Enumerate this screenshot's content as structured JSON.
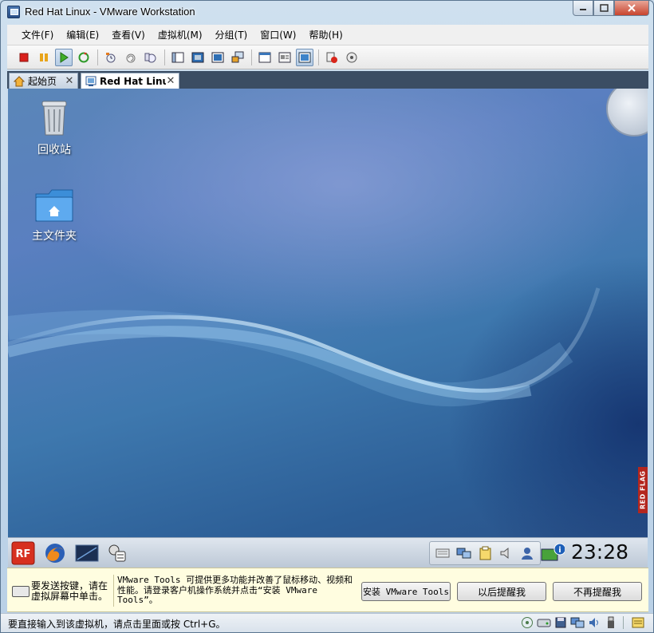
{
  "window": {
    "title": "Red Hat Linux - VMware Workstation"
  },
  "menu": [
    "文件(F)",
    "编辑(E)",
    "查看(V)",
    "虚拟机(M)",
    "分组(T)",
    "窗口(W)",
    "帮助(H)"
  ],
  "toolbar": {
    "groups": [
      [
        "stop-icon",
        "pause-icon",
        "play-icon",
        "reset-icon"
      ],
      [
        "snapshot-icon",
        "revert-snapshot-icon",
        "snapshot-manager-icon"
      ],
      [
        "sidebar-icon",
        "fullscreen-icon",
        "quick-switch-icon",
        "console-view-icon"
      ],
      [
        "summary-view-icon",
        "appliance-view-icon",
        "console-tab-icon"
      ],
      [
        "team-icon",
        "settings-icon"
      ]
    ],
    "pressed": [
      "play-icon",
      "console-tab-icon"
    ]
  },
  "tabs": [
    {
      "label": "起始页",
      "icon": "home-icon",
      "active": false
    },
    {
      "label": "Red Hat Linux",
      "icon": "vm-icon",
      "active": true
    }
  ],
  "desktop": {
    "icons": [
      {
        "label": "回收站",
        "icon": "trash-icon"
      },
      {
        "label": "主文件夹",
        "icon": "home-folder-icon"
      }
    ],
    "red_flag_text": "RED FLAG"
  },
  "guest_panel": {
    "launchers": [
      "red-flag-menu-icon",
      "firefox-icon",
      "terminal-icon",
      "settings-tools-icon"
    ],
    "tray": [
      "keyboard-icon",
      "network-icon",
      "clipboard-icon",
      "volume-icon",
      "user-switch-icon"
    ],
    "clock": "23:28",
    "start_label": "RF"
  },
  "notification": {
    "hint": "要发送按键，请在虚拟屏幕中单击。",
    "message": "VMware Tools 可提供更多功能并改善了鼠标移动、视频和性能。请登录客户机操作系统并点击“安装 VMware Tools”。",
    "install_button": "安装 VMware Tools",
    "remind_later_button": "以后提醒我",
    "never_remind_button": "不再提醒我"
  },
  "status": {
    "text": "要直接输入到该虚拟机，请点击里面或按 Ctrl+G。",
    "icons": [
      "cdrom-icon",
      "hard-disk-icon",
      "floppy-icon",
      "network-adapter-icon",
      "sound-icon",
      "usb-icon",
      "message-log-icon"
    ]
  },
  "colors": {
    "tabbar": "#3b4d63",
    "notify_bg": "#fffde0",
    "desktop_blue": "#3e78ae"
  }
}
